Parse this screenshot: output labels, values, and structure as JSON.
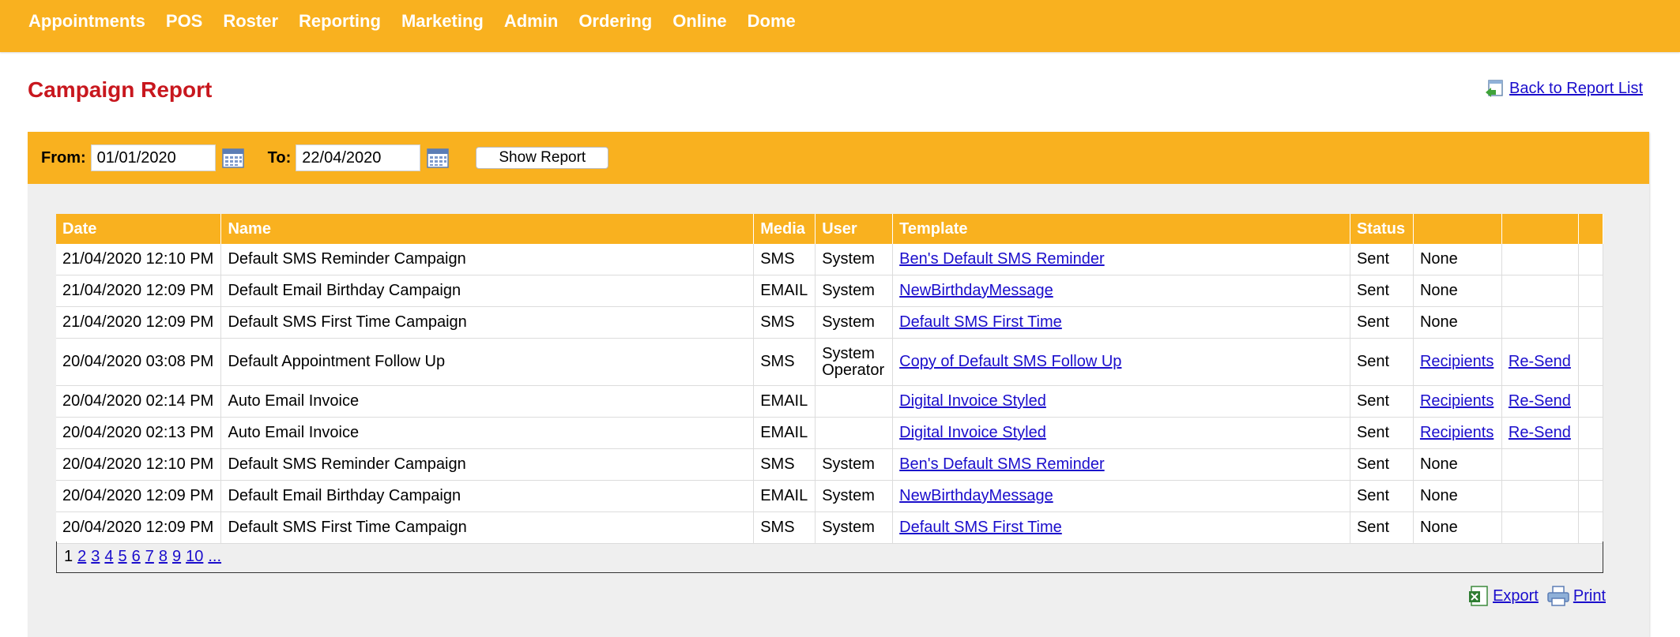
{
  "nav": [
    "Appointments",
    "POS",
    "Roster",
    "Reporting",
    "Marketing",
    "Admin",
    "Ordering",
    "Online",
    "Dome"
  ],
  "page_title": "Campaign Report",
  "back_link": "Back to Report List",
  "filter": {
    "from_label": "From:",
    "from_value": "01/01/2020",
    "to_label": "To:",
    "to_value": "22/04/2020",
    "show_button": "Show Report"
  },
  "table": {
    "headers": [
      "Date",
      "Name",
      "Media",
      "User",
      "Template",
      "Status",
      "",
      ""
    ],
    "rows": [
      {
        "date": "21/04/2020 12:10 PM",
        "name": "Default SMS Reminder Campaign",
        "media": "SMS",
        "user": "System",
        "template": "Ben's Default SMS Reminder",
        "status": "Sent",
        "recipients": "None",
        "resend": ""
      },
      {
        "date": "21/04/2020 12:09 PM",
        "name": "Default Email Birthday Campaign",
        "media": "EMAIL",
        "user": "System",
        "template": "NewBirthdayMessage",
        "status": "Sent",
        "recipients": "None",
        "resend": ""
      },
      {
        "date": "21/04/2020 12:09 PM",
        "name": "Default SMS First Time Campaign",
        "media": "SMS",
        "user": "System",
        "template": "Default SMS First Time",
        "status": "Sent",
        "recipients": "None",
        "resend": ""
      },
      {
        "date": "20/04/2020 03:08 PM",
        "name": "Default Appointment Follow Up",
        "media": "SMS",
        "user": "System Operator",
        "template": "Copy of Default SMS Follow Up",
        "status": "Sent",
        "recipients": "Recipients",
        "resend": "Re-Send"
      },
      {
        "date": "20/04/2020 02:14 PM",
        "name": "Auto Email Invoice",
        "media": "EMAIL",
        "user": "",
        "template": "Digital Invoice Styled",
        "status": "Sent",
        "recipients": "Recipients",
        "resend": "Re-Send"
      },
      {
        "date": "20/04/2020 02:13 PM",
        "name": "Auto Email Invoice",
        "media": "EMAIL",
        "user": "",
        "template": "Digital Invoice Styled",
        "status": "Sent",
        "recipients": "Recipients",
        "resend": "Re-Send"
      },
      {
        "date": "20/04/2020 12:10 PM",
        "name": "Default SMS Reminder Campaign",
        "media": "SMS",
        "user": "System",
        "template": "Ben's Default SMS Reminder",
        "status": "Sent",
        "recipients": "None",
        "resend": ""
      },
      {
        "date": "20/04/2020 12:09 PM",
        "name": "Default Email Birthday Campaign",
        "media": "EMAIL",
        "user": "System",
        "template": "NewBirthdayMessage",
        "status": "Sent",
        "recipients": "None",
        "resend": ""
      },
      {
        "date": "20/04/2020 12:09 PM",
        "name": "Default SMS First Time Campaign",
        "media": "SMS",
        "user": "System",
        "template": "Default SMS First Time",
        "status": "Sent",
        "recipients": "None",
        "resend": ""
      }
    ]
  },
  "pager": {
    "current": "1",
    "pages": [
      "2",
      "3",
      "4",
      "5",
      "6",
      "7",
      "8",
      "9",
      "10",
      "..."
    ]
  },
  "actions": {
    "export": "Export",
    "print": "Print"
  },
  "colors": {
    "accent": "#f9b11f",
    "title": "#c8171e",
    "link": "#1a0dcc"
  }
}
